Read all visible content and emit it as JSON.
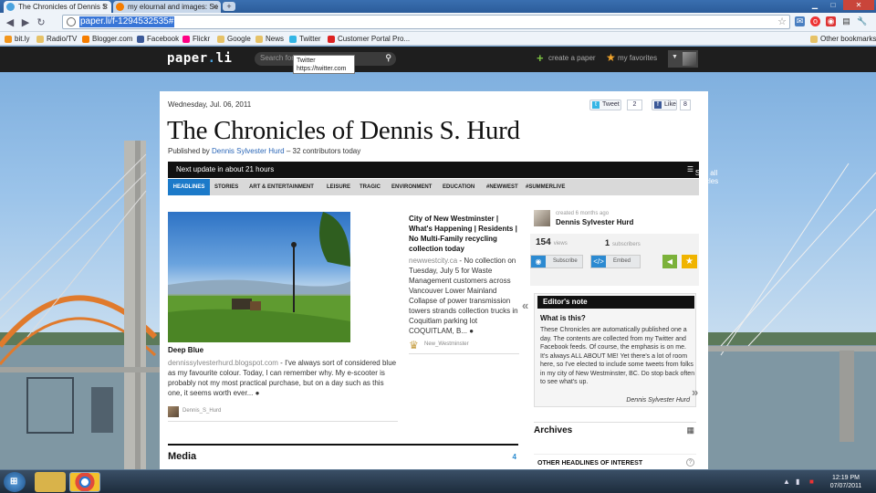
{
  "browser": {
    "tabs": [
      {
        "title": "The Chronicles of Dennis S",
        "icon": "paperli-icon",
        "active": true
      },
      {
        "title": "my elournal and images: Se",
        "icon": "blogger-icon",
        "active": false
      }
    ],
    "url": "paper.li/f-1294532535#",
    "bookmarks": [
      {
        "label": "bit.ly",
        "icon": "bitly-icon",
        "color": "#f2961d"
      },
      {
        "label": "Radio/TV",
        "icon": "folder-icon",
        "color": "#e6c267"
      },
      {
        "label": "Blogger.com",
        "icon": "blogger-icon",
        "color": "#f57d00"
      },
      {
        "label": "Facebook",
        "icon": "facebook-icon",
        "color": "#3b5998"
      },
      {
        "label": "Flickr",
        "icon": "flickr-icon",
        "color": "#ff0084"
      },
      {
        "label": "Google",
        "icon": "folder-icon",
        "color": "#e6c267"
      },
      {
        "label": "News",
        "icon": "folder-icon",
        "color": "#e6c267"
      },
      {
        "label": "Twitter",
        "icon": "twitter-icon",
        "color": "#33b5e5"
      },
      {
        "label": "Customer Portal Pro...",
        "icon": "portal-icon",
        "color": "#d22"
      }
    ],
    "other_bookmarks": "Other bookmarks",
    "tooltip": {
      "line1": "Twitter",
      "line2": "https://twitter.com"
    }
  },
  "paperli": {
    "logo_text": "paper",
    "logo_dot": ".",
    "logo_suffix": "li",
    "search_placeholder": "Search for p",
    "create_label": "create a paper",
    "favorites_label": "my favorites"
  },
  "paper": {
    "date": "Wednesday, Jul. 06, 2011",
    "tweet_label": "Tweet",
    "tweet_count": "2",
    "like_label": "Like",
    "like_count": "8",
    "title": "The Chronicles of Dennis S. Hurd",
    "published_prefix": "Published by ",
    "published_author": "Dennis Sylvester Hurd",
    "published_suffix": " – 32 contributors today",
    "next_update": "Next update in about 21 hours",
    "see_all": "See all articles",
    "tabs": [
      "HEADLINES",
      "STORIES",
      "ART & ENTERTAINMENT",
      "LEISURE",
      "TRAGIC",
      "ENVIRONMENT",
      "EDUCATION",
      "#NEWWEST",
      "#SUMMERLIVE"
    ]
  },
  "headline": {
    "title": "Deep Blue",
    "source": "dennissylvesterhurd.blogspot.com",
    "text": " - I've always sort of considered blue as my favourite colour. Today, I can remember why. My e-scooter is probably not my most practical purchase, but on a day such as this one, it seems worth ever...",
    "byline": "Dennis_S_Hurd"
  },
  "article2": {
    "title": "City of New Westminster | What's Happening | Residents | No Multi-Family recycling collection today",
    "source": "newwestcity.ca",
    "text": " - No collection on Tuesday, July 5 for Waste Management customers across Vancouver Lower Mainland Collapse of power transmission towers strands collection trucks in Coquitlam parking lot COQUITLAM, B...",
    "byline": "New_Westminster"
  },
  "media": {
    "label": "Media",
    "count": "4"
  },
  "sidebar": {
    "created": "created 6 months ago",
    "owner": "Dennis Sylvester Hurd",
    "views_count": "154",
    "views_label": "views",
    "subs_count": "1",
    "subs_label": "subscribers",
    "subscribe_label": "Subscribe",
    "embed_label": "Embed",
    "editors_note_title": "Editor's note",
    "editors_note_question": "What is this?",
    "editors_note_text": "These Chronicles are automatically published one a day. The contents are collected from my Twitter and Facebook feeds.  Of course, the emphasis is on me.  It's always ALL ABOUT ME!   Yet there's a lot of room here, so I've elected to include some tweets from folks in my city of New Westminster, BC. Do stop back often to see what's up.",
    "editors_note_signature": "Dennis Sylvester Hurd",
    "archives": "Archives",
    "other_headlines": "OTHER HEADLINES OF INTEREST"
  },
  "taskbar": {
    "time": "12:19 PM",
    "date": "07/07/2011"
  }
}
